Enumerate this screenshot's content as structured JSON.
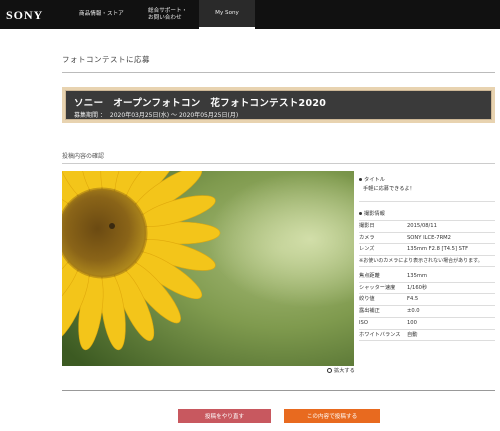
{
  "header": {
    "logo": "SONY",
    "nav": [
      {
        "label": "商品情報・ストア"
      },
      {
        "line1": "総合サポート・",
        "line2": "お問い合わせ"
      },
      {
        "label": "My Sony"
      }
    ]
  },
  "page": {
    "title": "フォトコンテストに応募"
  },
  "banner": {
    "title": "ソニー　オープンフォトコン　花フォトコンテスト2020",
    "period_label": "募集期間 ：",
    "period_value": "2020年03月25日(水) ～ 2020年05月25日(月)"
  },
  "confirm_label": "投稿内容の確認",
  "zoom_label": "拡大する",
  "info": {
    "title_heading": "タイトル",
    "title_value": "手軽に応募できるよ！",
    "shooting_heading": "撮影情報",
    "rows_top": [
      {
        "k": "撮影日",
        "v": "2015/08/11"
      },
      {
        "k": "カメラ",
        "v": "SONY ILCE-7RM2"
      },
      {
        "k": "レンズ",
        "v": "135mm F2.8 [T4.5] STF"
      }
    ],
    "note": "※お使いのカメラにより表示されない場合があります。",
    "rows_bottom": [
      {
        "k": "焦点距離",
        "v": "135mm"
      },
      {
        "k": "シャッター速度",
        "v": "1/160秒"
      },
      {
        "k": "絞り値",
        "v": "F4.5"
      },
      {
        "k": "露出補正",
        "v": "±0.0"
      },
      {
        "k": "ISO",
        "v": "100"
      },
      {
        "k": "ホワイトバランス",
        "v": "自動"
      }
    ]
  },
  "buttons": {
    "back": "投稿をやり直す",
    "submit": "この内容で投稿する"
  },
  "colors": {
    "back": "#c8585f",
    "submit": "#e86a1f",
    "banner_bg": "#3a3a3a",
    "banner_frame": "#e8d3b0"
  }
}
